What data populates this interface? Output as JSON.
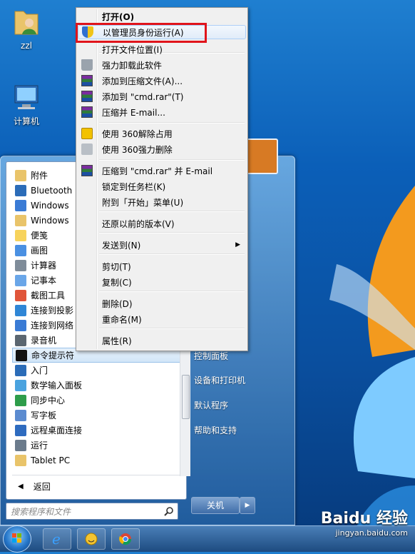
{
  "desktop": {
    "icons": [
      {
        "label": "zzl"
      },
      {
        "label": "计算机"
      }
    ]
  },
  "start_menu": {
    "programs": [
      {
        "label": "附件",
        "icon": "folder-icon"
      },
      {
        "label": "Bluetooth",
        "icon": "bluetooth-icon"
      },
      {
        "label": "Windows",
        "icon": "window-icon"
      },
      {
        "label": "Windows",
        "icon": "folder-window-icon"
      },
      {
        "label": "便笺",
        "icon": "sticky-note-icon"
      },
      {
        "label": "画图",
        "icon": "paint-icon"
      },
      {
        "label": "计算器",
        "icon": "calculator-icon"
      },
      {
        "label": "记事本",
        "icon": "notepad-icon"
      },
      {
        "label": "截图工具",
        "icon": "snipping-icon"
      },
      {
        "label": "连接到投影",
        "icon": "projector-icon"
      },
      {
        "label": "连接到网络",
        "icon": "network-icon"
      },
      {
        "label": "录音机",
        "icon": "microphone-icon"
      },
      {
        "label": "命令提示符",
        "icon": "cmd-icon"
      },
      {
        "label": "入门",
        "icon": "getting-started-icon"
      },
      {
        "label": "数学输入面板",
        "icon": "math-panel-icon"
      },
      {
        "label": "同步中心",
        "icon": "sync-icon"
      },
      {
        "label": "写字板",
        "icon": "wordpad-icon"
      },
      {
        "label": "远程桌面连接",
        "icon": "remote-desktop-icon"
      },
      {
        "label": "运行",
        "icon": "run-icon"
      },
      {
        "label": "Tablet PC",
        "icon": "folder-icon"
      }
    ],
    "back_label": "返回",
    "search_placeholder": "搜索程序和文件",
    "right_items": [
      {
        "label": "控制面板"
      },
      {
        "label": "设备和打印机"
      },
      {
        "label": "默认程序"
      },
      {
        "label": "帮助和支持"
      }
    ],
    "shutdown_label": "关机"
  },
  "context_menu": {
    "items": [
      {
        "label": "打开(O)",
        "bold": true,
        "icon": ""
      },
      {
        "label": "以管理员身份运行(A)",
        "icon": "uac-shield-icon",
        "highlighted": true
      },
      {
        "label": "打开文件位置(I)",
        "icon": ""
      },
      {
        "label": "强力卸载此软件",
        "icon": "trash-icon"
      },
      {
        "label": "添加到压缩文件(A)...",
        "icon": "winrar-icon"
      },
      {
        "label": "添加到 \"cmd.rar\"(T)",
        "icon": "winrar-icon"
      },
      {
        "label": "压缩并 E-mail...",
        "icon": "winrar-icon"
      },
      {
        "label": "使用 360解除占用",
        "icon": "360-unlock-icon"
      },
      {
        "label": "使用 360强力删除",
        "icon": "360-shred-icon"
      },
      {
        "label": "压缩到 \"cmd.rar\" 并 E-mail",
        "icon": "winrar-icon"
      },
      {
        "label": "锁定到任务栏(K)",
        "icon": ""
      },
      {
        "label": "附到「开始」菜单(U)",
        "icon": ""
      },
      {
        "label": "还原以前的版本(V)",
        "icon": ""
      },
      {
        "label": "发送到(N)",
        "icon": "",
        "submenu": true
      },
      {
        "label": "剪切(T)",
        "icon": ""
      },
      {
        "label": "复制(C)",
        "icon": ""
      },
      {
        "label": "删除(D)",
        "icon": ""
      },
      {
        "label": "重命名(M)",
        "icon": ""
      },
      {
        "label": "属性(R)",
        "icon": ""
      }
    ]
  },
  "watermark": {
    "brand": "Baidu 经验",
    "url": "jingyan.baidu.com"
  },
  "colors": {
    "highlight_box": "#e0141b",
    "menu_bg": "#f0f0f0",
    "desktop_blue": "#0b5fb8"
  }
}
